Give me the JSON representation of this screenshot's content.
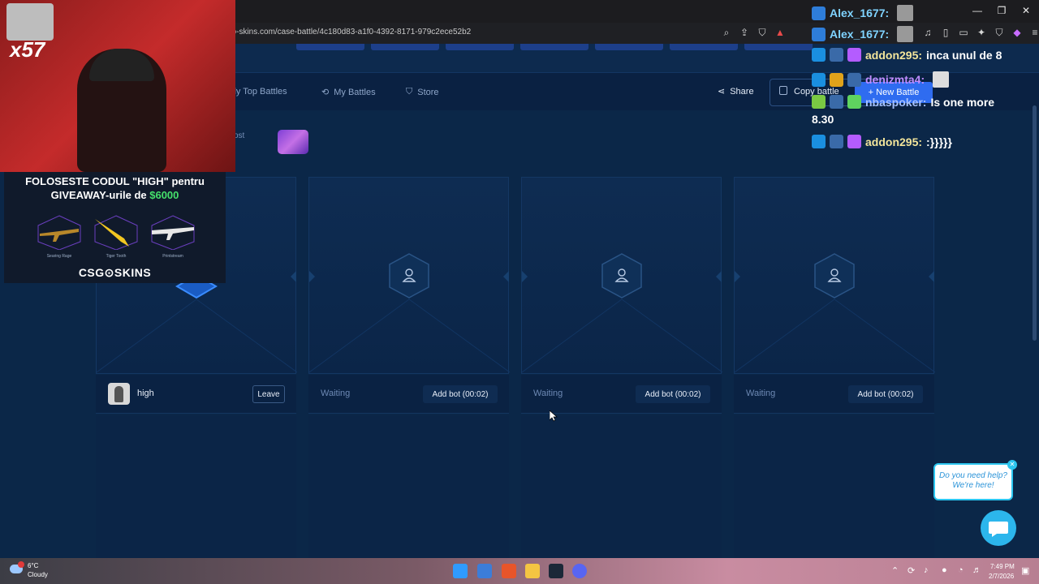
{
  "browser": {
    "url": "go-skins.com/case-battle/4c180d83-a1f0-4392-8171-979c2ece52b2"
  },
  "nav": {
    "items": [
      {
        "label": "ily Top Battles",
        "icon": "trophy-icon"
      },
      {
        "label": "My Battles",
        "icon": "history-icon"
      },
      {
        "label": "Store",
        "icon": "basket-icon"
      }
    ],
    "share_label": "Share",
    "copy_label": "Copy battle",
    "new_battle_label": "+ New Battle"
  },
  "battle": {
    "cost_label": "ost"
  },
  "players": [
    {
      "status": "",
      "name": "high",
      "action": "Leave"
    },
    {
      "status": "Waiting",
      "name": "",
      "action": "Add bot (00:02)"
    },
    {
      "status": "Waiting",
      "name": "",
      "action": "Add bot (00:02)"
    },
    {
      "status": "Waiting",
      "name": "",
      "action": "Add bot (00:02)"
    }
  ],
  "stream": {
    "multiplier": "x57",
    "promo_line1": "FOLOSESTE CODUL \"HIGH\" pentru",
    "promo_line2_prefix": "GIVEAWAY-urile de ",
    "promo_amount": "$6000",
    "guns": [
      "Searing Rage",
      "Tiger Tooth",
      "Printstream"
    ],
    "brand": "CSG⊙SKINS"
  },
  "chat": [
    {
      "user": "Alex_1677:",
      "text": "",
      "user_color": "#7fd3ff"
    },
    {
      "user": "Alex_1677:",
      "text": "",
      "user_color": "#7fd3ff"
    },
    {
      "user": "addon295:",
      "text": "inca unul de 8",
      "user_color": "#f3e59b"
    },
    {
      "user": "denizmta4:",
      "text": "",
      "user_color": "#c08cff"
    },
    {
      "user": "nbaspoker:",
      "text": "Is one more",
      "user_color": "#a7c2ff"
    },
    {
      "user": "",
      "text": "8.30",
      "user_color": "#ffffff"
    },
    {
      "user": "addon295:",
      "text": ":}}}}}",
      "user_color": "#f3e59b"
    }
  ],
  "help": {
    "text_line1": "Do you need help?",
    "text_line2": "We're here!"
  },
  "taskbar": {
    "weather_temp": "6°C",
    "weather_desc": "Cloudy",
    "time": "7:49 PM",
    "date": "2/7/2026"
  },
  "colors": {
    "accent": "#2f6cf0",
    "background": "#0b2748",
    "promo_amount": "#45e06b"
  }
}
